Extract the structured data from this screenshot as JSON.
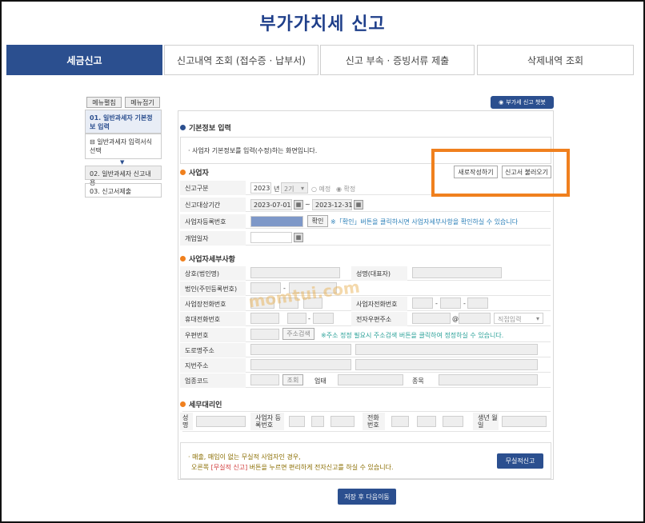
{
  "page_title": "부가가치세 신고",
  "tabs": [
    "세금신고",
    "신고내역 조회 (접수증 · 납부서)",
    "신고 부속 · 증빙서류 제출",
    "삭제내역 조회"
  ],
  "side": {
    "expand": "메뉴펼침",
    "collapse": "메뉴접기",
    "item1": "01. 일반과세자 기본정보 입력",
    "item1_sub": "일반과세자 입력서식 선택",
    "item2": "02. 일반과세자 신고내용",
    "item3": "03. 신고서제출"
  },
  "chatbot": "부가세 신고 챗봇",
  "basic_section": "기본정보 입력",
  "basic_notice": "· 사업자 기본정보를 입력(수정)하는 화면입니다.",
  "new_btn": "새로작성하기",
  "load_btn": "신고서 불러오기",
  "biz_section": "사업자",
  "labels": {
    "type": "신고구분",
    "period": "신고대상기간",
    "reg": "사업자등록번호",
    "open": "개업일자"
  },
  "year": "2023",
  "yearsuffix": "년",
  "term": "2기",
  "pre": "예정",
  "fin": "확정",
  "date_from": "2023-07-01",
  "tilde": "~",
  "date_to": "2023-12-31",
  "confirm": "확인",
  "confirm_note": "※「확인」버튼을 클릭하시면 사업자세부사항을 확인하실 수 있습니다",
  "detail_section": "사업자세부사항",
  "detail_labels": {
    "corp": "상호(법인명)",
    "name": "성명(대표자)",
    "corpno": "법인(주민등록번호)",
    "tel": "사업장전화번호",
    "hometel": "사업자전화번호",
    "mobile": "휴대전화번호",
    "email": "전자우편주소",
    "zip": "우편번호",
    "road": "도로명주소",
    "jibun": "지번주소",
    "code": "업종코드",
    "biz": "업태",
    "item": "종목"
  },
  "dash": "-",
  "at": "@",
  "direct": "직접입력",
  "zip_btn": "주소검색",
  "zip_note": "※주소 정정 필요시 주소검색 버튼을 클릭하여 정정하실 수 있습니다.",
  "lookup": "조회",
  "agent_section": "세무대리인",
  "agent": {
    "name": "성명",
    "bizno": "사업자 등록번호",
    "tel": "전화 번호",
    "birth": "생년 월일"
  },
  "notice_l1": "· 매출, 매입이 없는 무실적 사업자인 경우,",
  "notice_l2a": "오른쪽 ",
  "notice_l2b": "[무실적 신고]",
  "notice_l2c": " 버튼을 누르면 편리하게 전자신고를 하실 수 있습니다.",
  "zero_btn": "무실적신고",
  "save_btn": "저장 후 다음이동",
  "watermark": "momtui.com"
}
